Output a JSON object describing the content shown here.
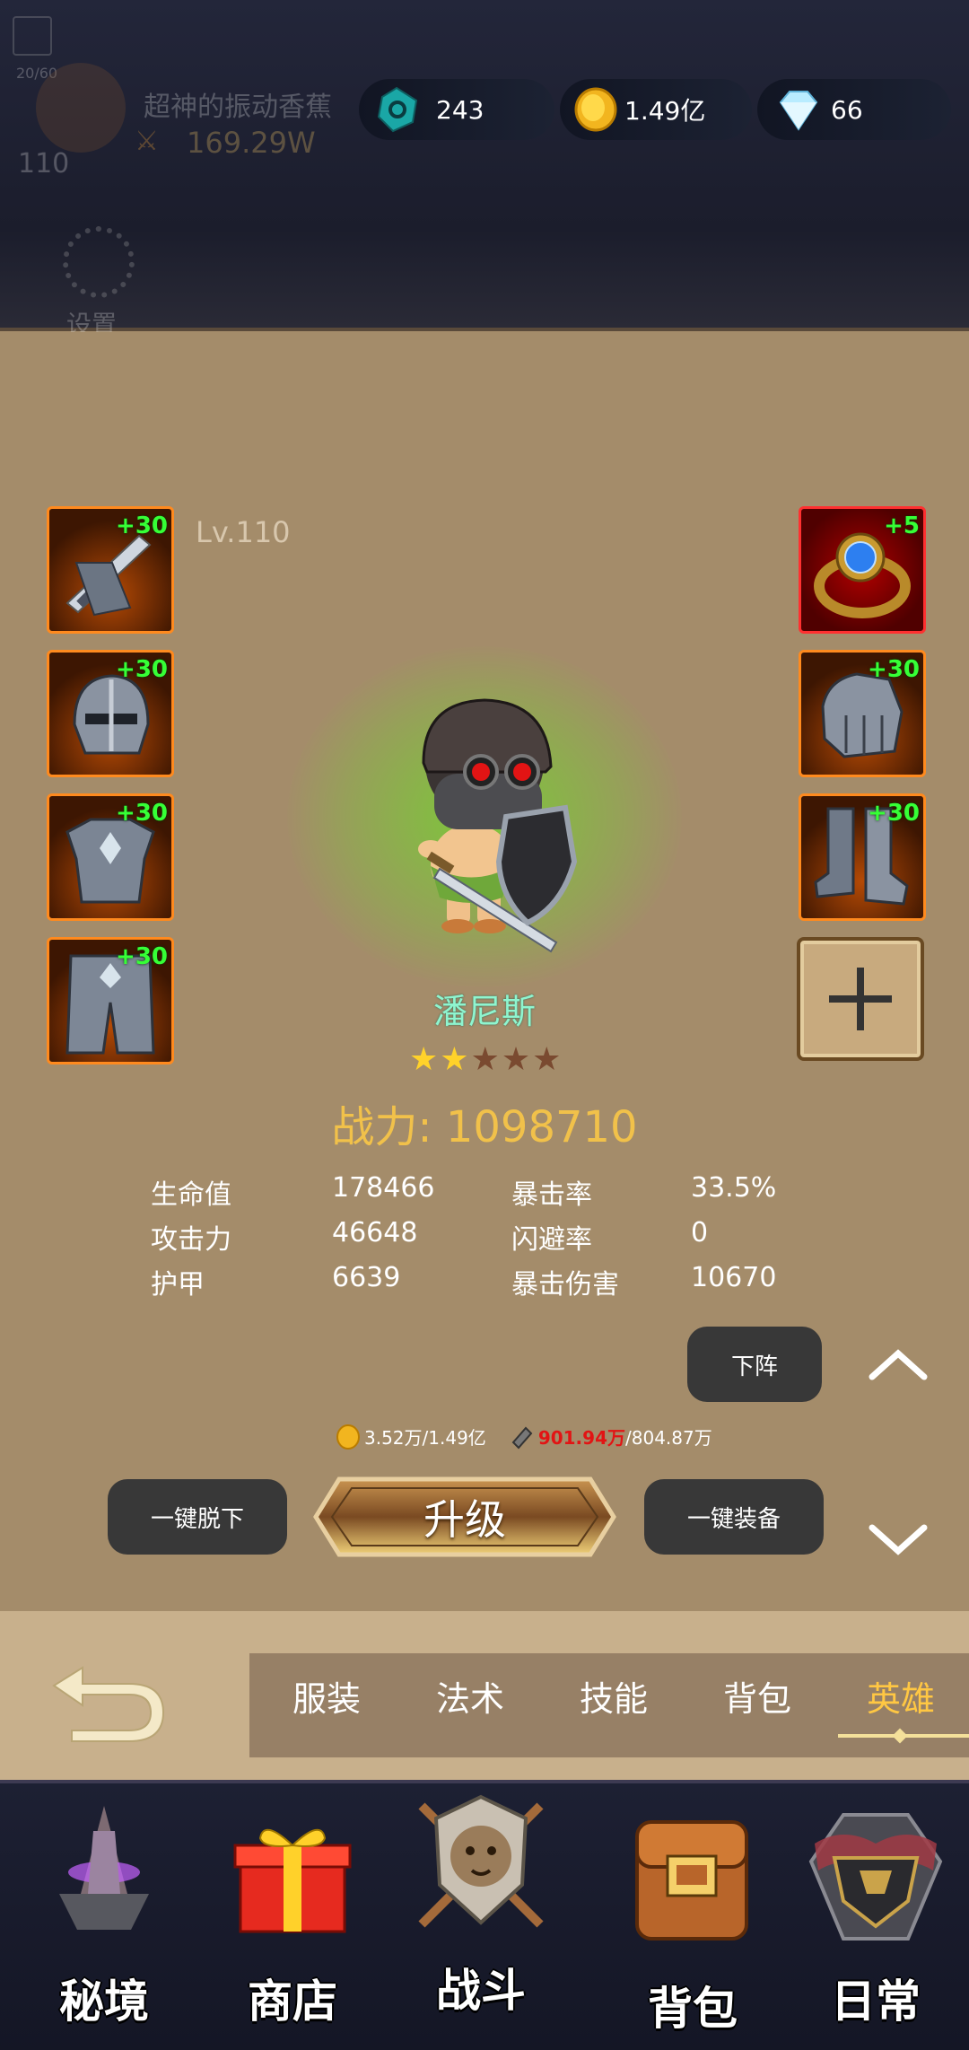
{
  "colors": {
    "accent_gold": "#f1c14a",
    "hero_name": "#8ff5cf",
    "plus_green": "#36ff36",
    "bg": "#a48c6a"
  },
  "player": {
    "name": "超神的振动香蕉",
    "power": "169.29W",
    "level": "110",
    "exp": "20/60",
    "settings_label": "设置"
  },
  "resources": [
    {
      "icon": "crystal-icon",
      "value": "243"
    },
    {
      "icon": "gold-coin-icon",
      "value": "1.49亿"
    },
    {
      "icon": "diamond-icon",
      "value": "66"
    }
  ],
  "hero": {
    "level": "Lv.110",
    "name": "潘尼斯",
    "stars_filled": 2,
    "stars_total": 5,
    "combat_power": "战力: 1098710",
    "stats": [
      {
        "label": "生命值",
        "value": "178466"
      },
      {
        "label": "暴击率",
        "value": "33.5%"
      },
      {
        "label": "攻击力",
        "value": "46648"
      },
      {
        "label": "闪避率",
        "value": "0"
      },
      {
        "label": "护甲",
        "value": "6639"
      },
      {
        "label": "暴击伤害",
        "value": "10670"
      }
    ]
  },
  "equipment_left": [
    {
      "icon": "sword-icon",
      "plus": "+30"
    },
    {
      "icon": "helmet-icon",
      "plus": "+30"
    },
    {
      "icon": "armor-icon",
      "plus": "+30"
    },
    {
      "icon": "leggings-icon",
      "plus": "+30"
    }
  ],
  "equipment_right": [
    {
      "icon": "ring-icon",
      "plus": "+5"
    },
    {
      "icon": "gauntlet-icon",
      "plus": "+30"
    },
    {
      "icon": "boots-icon",
      "plus": "+30"
    }
  ],
  "actions": {
    "unequip_hero": "下阵",
    "gold_cost": "3.52万/1.49亿",
    "material_have": "901.94万",
    "material_need": "/804.87万",
    "unequip_all": "一键脱下",
    "upgrade": "升级",
    "equip_all": "一键装备"
  },
  "tabs": [
    "服装",
    "法术",
    "技能",
    "背包",
    "英雄"
  ],
  "active_tab": "英雄",
  "nav": [
    {
      "icon": "secret-realm-icon",
      "label": "秘境"
    },
    {
      "icon": "gift-box-icon",
      "label": "商店"
    },
    {
      "icon": "lion-crest-icon",
      "label": "战斗"
    },
    {
      "icon": "backpack-icon",
      "label": "背包"
    },
    {
      "icon": "daily-emblem-icon",
      "label": "日常"
    }
  ]
}
